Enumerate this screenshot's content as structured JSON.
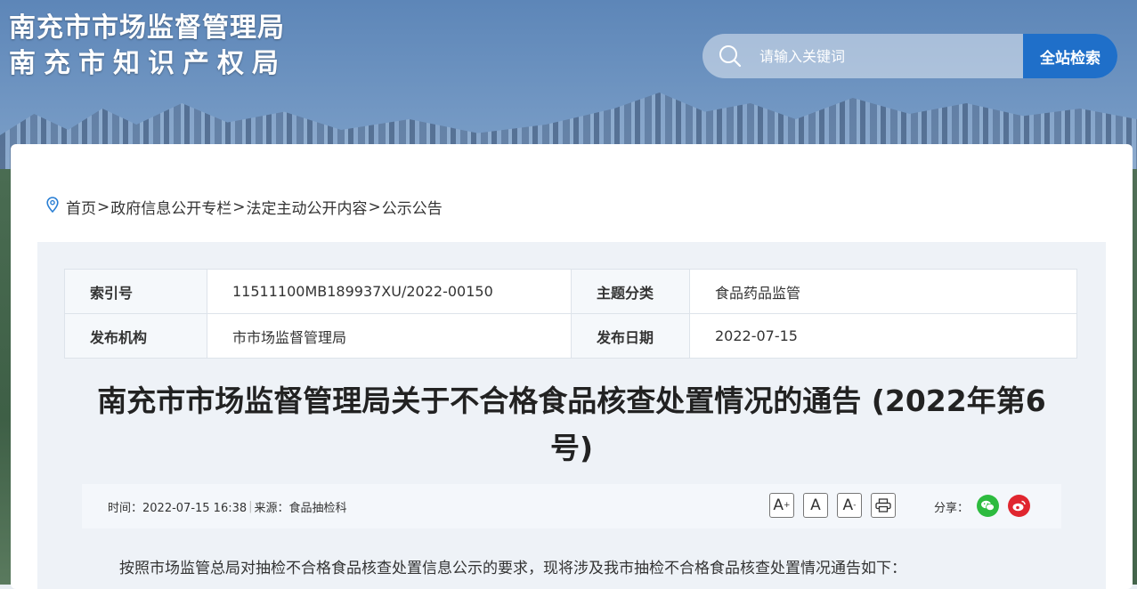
{
  "header": {
    "title_line1": "南充市市场监督管理局",
    "title_line2": "南充市知识产权局"
  },
  "search": {
    "placeholder": "请输入关键词",
    "button_label": "全站检索"
  },
  "breadcrumb": {
    "items": [
      "首页",
      "政府信息公开专栏",
      "法定主动公开内容",
      "公示公告"
    ],
    "separator": ">"
  },
  "meta": {
    "index_label": "索引号",
    "index_value": "11511100MB189937XU/2022-00150",
    "topic_label": "主题分类",
    "topic_value": "食品药品监管",
    "org_label": "发布机构",
    "org_value": "市市场监督管理局",
    "date_label": "发布日期",
    "date_value": "2022-07-15"
  },
  "article": {
    "title": "南充市市场监督管理局关于不合格食品核查处置情况的通告 (2022年第6号)",
    "time_text": "时间：2022-07-15 16:38",
    "source_text": "来源：食品抽检科",
    "share_label": "分享：",
    "body_first_line": "按照市场监管总局对抽检不合格食品核查处置信息公示的要求，现将涉及我市抽检不合格食品核查处置情况通告如下："
  },
  "tools": {
    "font_larger": "A",
    "font_normal": "A",
    "font_smaller": "A"
  },
  "colors": {
    "accent": "#1f6fc9",
    "wechat": "#2dbb3f",
    "weibo": "#e0262f"
  }
}
